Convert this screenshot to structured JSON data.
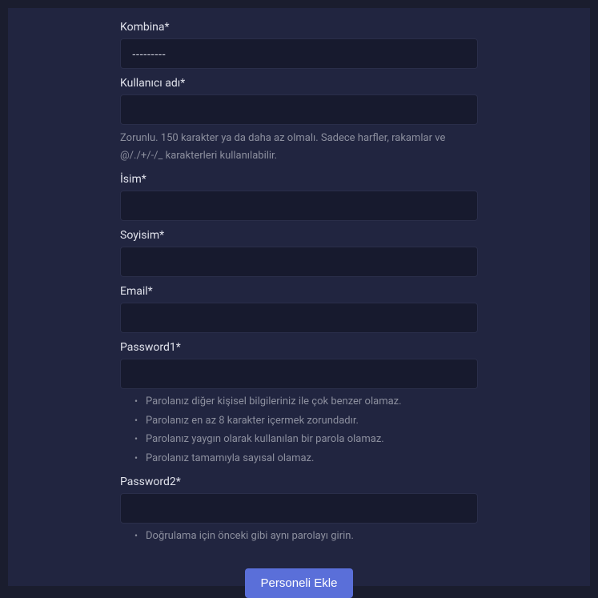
{
  "fields": {
    "kombina": {
      "label": "Kombina*",
      "selected": "---------"
    },
    "username": {
      "label": "Kullanıcı adı*",
      "help": "Zorunlu. 150 karakter ya da daha az olmalı. Sadece harfler, rakamlar ve @/./+/-/_ karakterleri kullanılabilir."
    },
    "firstname": {
      "label": "İsim*"
    },
    "lastname": {
      "label": "Soyisim*"
    },
    "email": {
      "label": "Email*"
    },
    "password1": {
      "label": "Password1*",
      "help": [
        "Parolanız diğer kişisel bilgileriniz ile çok benzer olamaz.",
        "Parolanız en az 8 karakter içermek zorundadır.",
        "Parolanız yaygın olarak kullanılan bir parola olamaz.",
        "Parolanız tamamıyla sayısal olamaz."
      ]
    },
    "password2": {
      "label": "Password2*",
      "help": [
        "Doğrulama için önceki gibi aynı parolayı girin."
      ]
    }
  },
  "submit_label": "Personeli Ekle"
}
